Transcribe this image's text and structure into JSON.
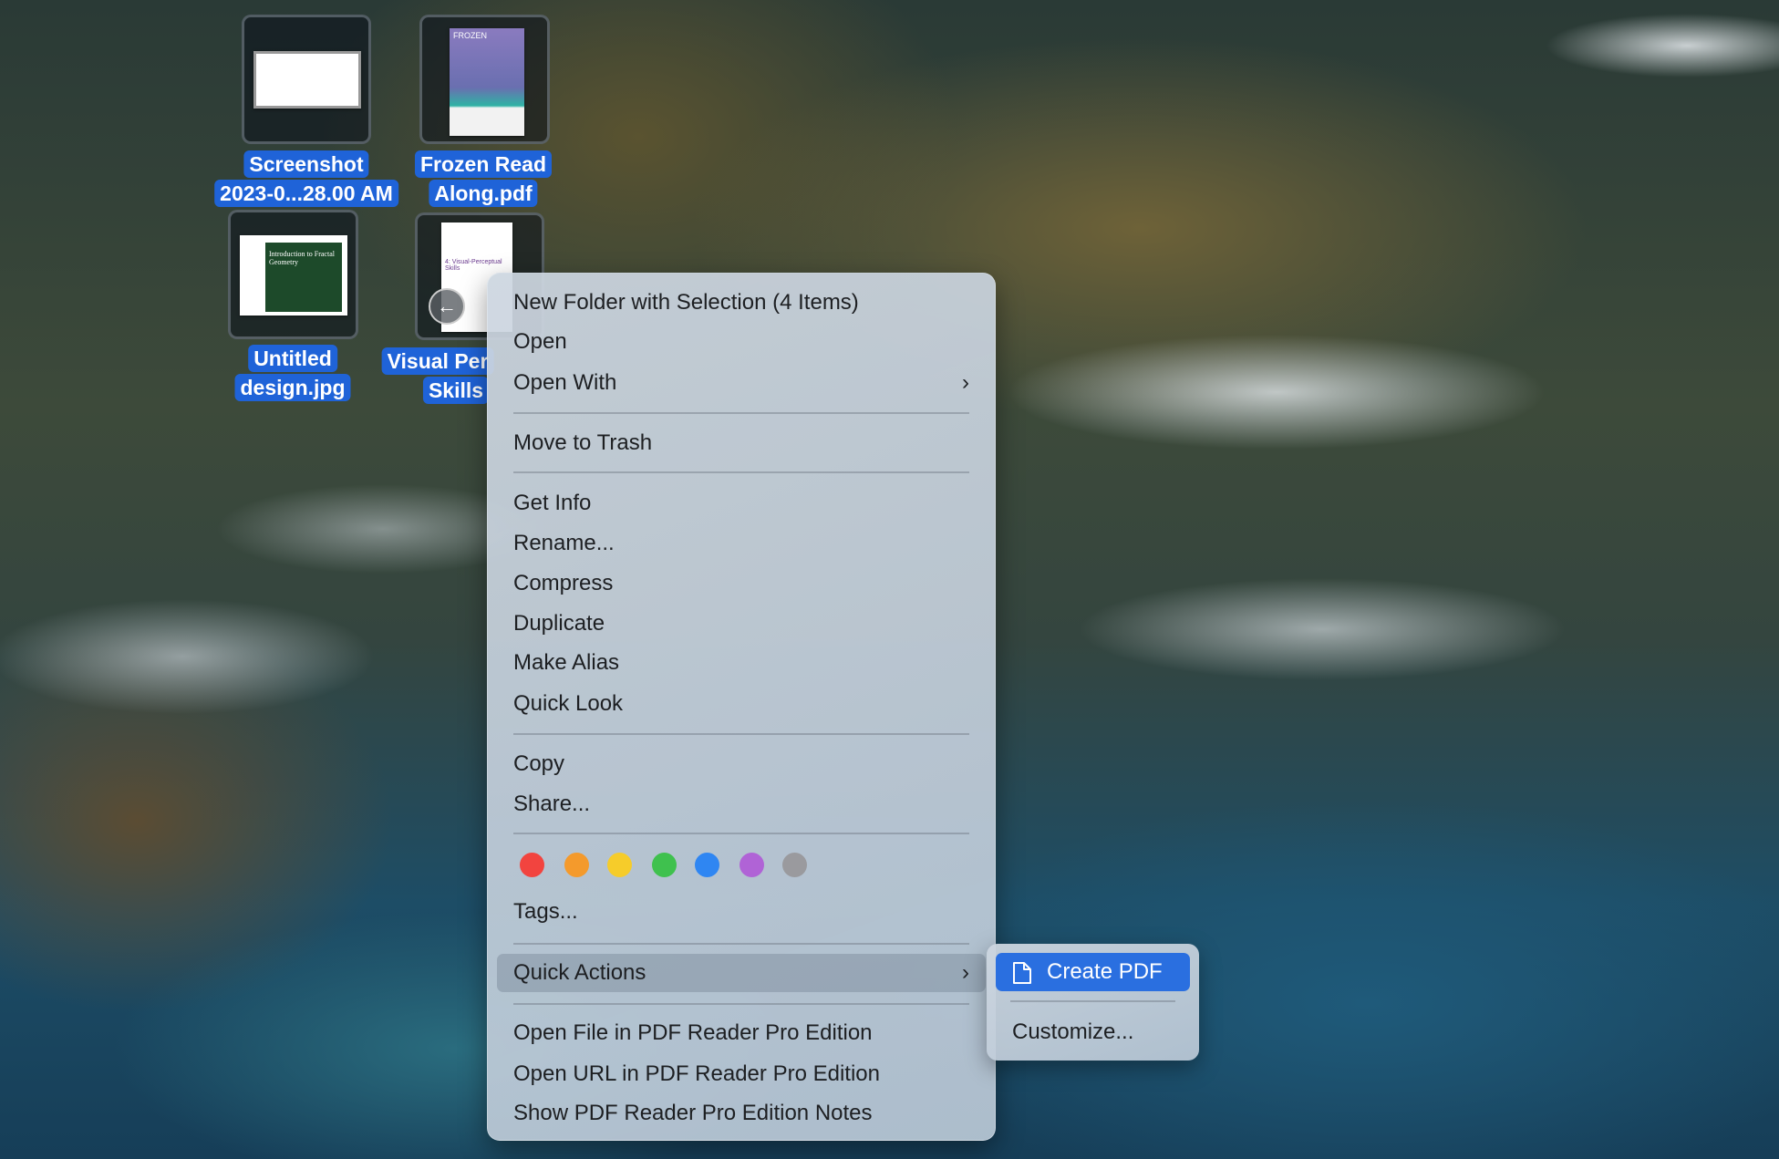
{
  "desktop_icons": [
    {
      "label_lines": [
        "Screenshot",
        "2023-0...28.00 AM"
      ]
    },
    {
      "label_lines": [
        "Frozen Read",
        "Along.pdf"
      ]
    },
    {
      "label_lines": [
        "Untitled",
        "design.jpg"
      ]
    },
    {
      "label_lines": [
        "Visual Per",
        "Skills"
      ]
    }
  ],
  "thumb_text": {
    "frozen": "FROZEN",
    "fractal": "Introduction to Fractal Geometry",
    "visual": "4: Visual-Perceptual Skills"
  },
  "context_menu": {
    "items": [
      "New Folder with Selection (4 Items)",
      "Open",
      "Open With",
      "Move to Trash",
      "Get Info",
      "Rename...",
      "Compress",
      "Duplicate",
      "Make Alias",
      "Quick Look",
      "Copy",
      "Share...",
      "Tags...",
      "Quick Actions",
      "Open File in PDF Reader Pro Edition",
      "Open URL in PDF Reader Pro Edition",
      "Show PDF Reader Pro Edition Notes"
    ],
    "tag_colors": [
      {
        "name": "red",
        "hex": "#f2443f"
      },
      {
        "name": "orange",
        "hex": "#f49a2c"
      },
      {
        "name": "yellow",
        "hex": "#f6cc2a"
      },
      {
        "name": "green",
        "hex": "#3fc14e"
      },
      {
        "name": "blue",
        "hex": "#2f86f2"
      },
      {
        "name": "purple",
        "hex": "#b063d6"
      },
      {
        "name": "gray",
        "hex": "#9a9a9e"
      }
    ],
    "chevron": "›"
  },
  "submenu": {
    "items": [
      "Create PDF",
      "Customize..."
    ],
    "accent": "#2a6fe0"
  }
}
